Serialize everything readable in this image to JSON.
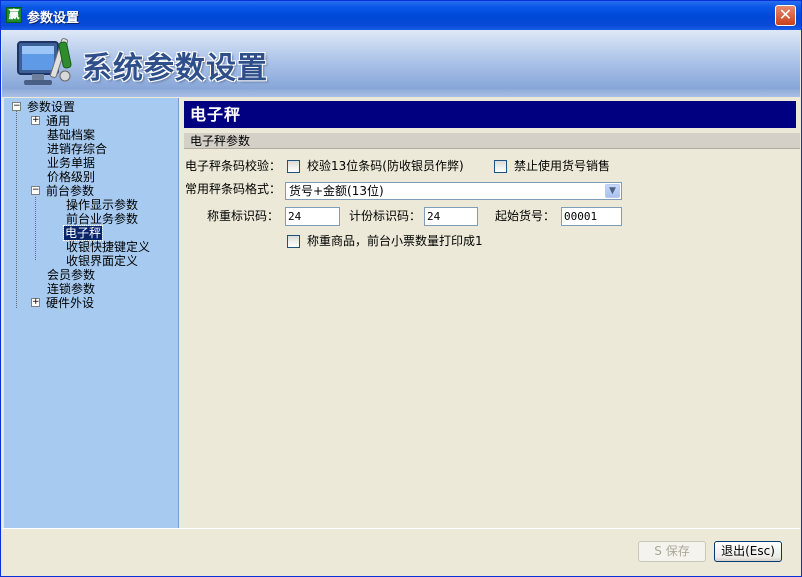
{
  "window": {
    "title": "参数设置",
    "app_icon_char": "赢",
    "close_icon": "close-x"
  },
  "banner": {
    "title": "系统参数设置",
    "logo_icon": "monitor-tools-icon"
  },
  "tree": {
    "root": "参数设置",
    "items": [
      {
        "label": "通用",
        "expander": "+"
      },
      {
        "label": "基础档案"
      },
      {
        "label": "进销存综合"
      },
      {
        "label": "业务单据"
      },
      {
        "label": "价格级别"
      },
      {
        "label": "前台参数",
        "expander": "−"
      },
      {
        "label": "操作显示参数"
      },
      {
        "label": "前台业务参数"
      },
      {
        "label": "电子秤"
      },
      {
        "label": "收银快捷键定义"
      },
      {
        "label": "收银界面定义"
      },
      {
        "label": "会员参数"
      },
      {
        "label": "连锁参数"
      },
      {
        "label": "硬件外设",
        "expander": "+"
      }
    ],
    "selected": "电子秤"
  },
  "content": {
    "section_title": "电子秤",
    "group_title": "电子秤参数",
    "barcode_check_label": "电子秤条码校验：",
    "check13_label": "校验13位条码(防收银员作弊)",
    "check13_checked": false,
    "forbid_item_label": "禁止使用货号销售",
    "forbid_item_checked": false,
    "format_label": "常用秤条码格式：",
    "format_value": "货号+金额(13位)",
    "weigh_code_label": "称重标识码：",
    "weigh_code_value": "24",
    "price_code_label": "计份标识码：",
    "price_code_value": "24",
    "start_item_label": "起始货号：",
    "start_item_value": "00001",
    "print_one_label": "称重商品，前台小票数量打印成1",
    "print_one_checked": false
  },
  "footer": {
    "save_label": "S 保存",
    "exit_label": "退出(Esc)"
  },
  "colors": {
    "titlebar": "#0047d6",
    "sidebar_bg": "#a6caf0",
    "section_header_bg": "#000080",
    "panel_bg": "#ece9d8"
  }
}
